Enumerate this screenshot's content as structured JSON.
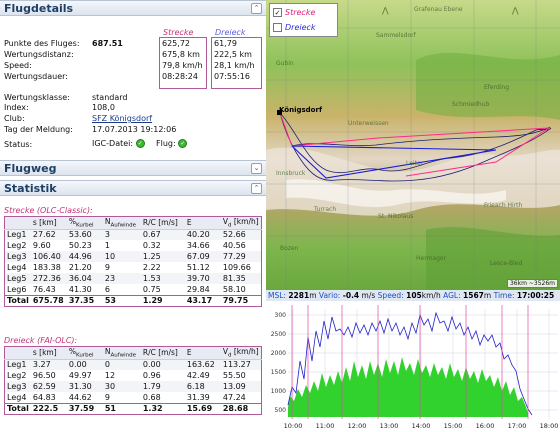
{
  "flugdetails": {
    "title": "Flugdetails",
    "labels": {
      "punkte": "Punkte des Fluges:",
      "distanz": "Wertungsdistanz:",
      "speed": "Speed:",
      "dauer": "Wertungsdauer:",
      "klasse": "Wertungsklasse:",
      "index": "Index:",
      "club": "Club:",
      "tag": "Tag der Meldung:",
      "status": "Status:"
    },
    "punkte_value": "687.51",
    "klasse_value": "standard",
    "index_value": "108,0",
    "club_value": "SFZ Königsdorf",
    "tag_value": "17.07.2013 19:12:06",
    "igc_label": "IGC-Datei:",
    "flug_label": "Flug:",
    "strecke": {
      "header": "Strecke",
      "distanz": "675,8 km",
      "speed": "79,8 km/h",
      "dauer": "08:28:24",
      "punkte": "625,72"
    },
    "dreieck": {
      "header": "Dreieck",
      "distanz": "222,5 km",
      "speed": "28,1 km/h",
      "dauer": "07:55:16",
      "punkte": "61,79"
    }
  },
  "flugweg": {
    "title": "Flugweg"
  },
  "statistik": {
    "title": "Statistik",
    "olc_title": "Strecke (OLC-Classic):",
    "fai_title": "Dreieck (FAI-OLC):",
    "columns": [
      "",
      "s [km]",
      "%Kurbel",
      "NAufwinde",
      "R/C [m/s]",
      "E",
      "Vd [km/h]"
    ],
    "olc_rows": [
      [
        "Leg1",
        "27.62",
        "53.60",
        "3",
        "0.67",
        "40.20",
        "52.66"
      ],
      [
        "Leg2",
        "9.60",
        "50.23",
        "1",
        "0.32",
        "34.66",
        "40.56"
      ],
      [
        "Leg3",
        "106.40",
        "44.96",
        "10",
        "1.25",
        "67.09",
        "77.29"
      ],
      [
        "Leg4",
        "183.38",
        "21.20",
        "9",
        "2.22",
        "51.12",
        "109.66"
      ],
      [
        "Leg5",
        "272.36",
        "36.04",
        "23",
        "1.53",
        "39.70",
        "81.35"
      ],
      [
        "Leg6",
        "76.43",
        "41.30",
        "6",
        "0.75",
        "29.84",
        "58.10"
      ]
    ],
    "olc_total": [
      "Total",
      "675.78",
      "37.35",
      "53",
      "1.29",
      "43.17",
      "79.75"
    ],
    "fai_rows": [
      [
        "Leg1",
        "3.27",
        "0.00",
        "0",
        "0.00",
        "163.62",
        "113.27"
      ],
      [
        "Leg2",
        "96.50",
        "49.97",
        "12",
        "0.96",
        "42.49",
        "55.50"
      ],
      [
        "Leg3",
        "62.59",
        "31.30",
        "30",
        "1.79",
        "6.18",
        "13.09"
      ],
      [
        "Leg4",
        "64.83",
        "44.62",
        "9",
        "0.68",
        "31.39",
        "47.24"
      ]
    ],
    "fai_total": [
      "Total",
      "222.5",
      "37.59",
      "51",
      "1.32",
      "15.69",
      "28.68"
    ]
  },
  "map": {
    "legend": {
      "strecke": "Strecke",
      "dreieck": "Dreieck"
    },
    "start_label": "Königsdorf",
    "place_labels": [
      "Grafenau Ebene",
      "Sammelsdorf",
      "Eferding",
      "Unterweissen",
      "Schmiedhub",
      "Innsbruck",
      "St. Nikolaus",
      "Bozen",
      "Frieach Hirth",
      "Lesce-Bled",
      "Hermagor",
      "Turrach",
      "Leiter",
      "Gubin"
    ],
    "scale": "36km  ~3526m",
    "colors": {
      "strecke": "#ff2a8a",
      "dreieck": "#1a1adf",
      "track": "#1c1c6e"
    }
  },
  "barogram": {
    "readout": {
      "msl_label": "MSL:",
      "msl": "2281",
      "msl_unit": "m",
      "vario_label": "Vario:",
      "vario": "-0.4",
      "vario_unit": "m/s",
      "speed_label": "Speed:",
      "speed": "105",
      "speed_unit": "km/h",
      "agl_label": "AGL:",
      "agl": "1567",
      "agl_unit": "m",
      "time_label": "Time:",
      "time": "17:00:25"
    },
    "y_ticks": [
      "300",
      "2500",
      "2000",
      "1500",
      "1000",
      "500"
    ],
    "x_ticks": [
      "10:00",
      "11:00",
      "12:00",
      "13:00",
      "14:00",
      "15:00",
      "16:00",
      "17:00",
      "18:00"
    ],
    "colors": {
      "altitude": "#2020c8",
      "ground": "#32d22e",
      "markers": "#e04aa0"
    }
  }
}
